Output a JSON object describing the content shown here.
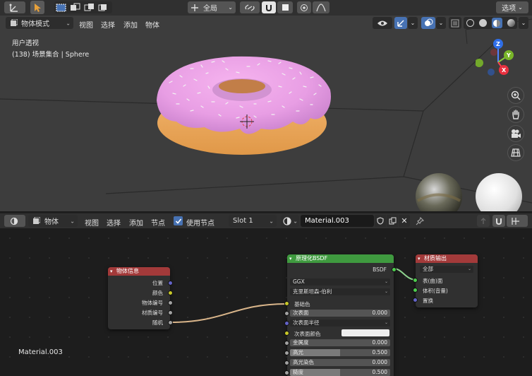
{
  "top_header": {
    "transform_label": "全局",
    "options_label": "选项"
  },
  "viewport": {
    "mode": "物体模式",
    "menus": [
      "视图",
      "选择",
      "添加",
      "物体"
    ],
    "overlay_line1": "用户透视",
    "overlay_line2": "(138) 场景集合 | Sphere",
    "gizmo": {
      "z": "Z",
      "y": "Y",
      "x": "X"
    }
  },
  "node_header": {
    "object_type": "物体",
    "menus": [
      "视图",
      "选择",
      "添加",
      "节点"
    ],
    "use_nodes_label": "使用节点",
    "slot": "Slot 1",
    "material_name": "Material.003"
  },
  "node_editor": {
    "material_label": "Material.003",
    "object_info": {
      "title": "物体信息",
      "outputs": [
        "位置",
        "颜色",
        "物体编号",
        "材质编号",
        "随机"
      ]
    },
    "principled": {
      "title": "原理化BSDF",
      "output": "BSDF",
      "distribution": "GGX",
      "subsurface_method": "克里斯坦森-伯利",
      "base_color": "基础色",
      "subsurface_label": "次表面",
      "subsurface_value": "0.000",
      "subsurface_radius": "次表面半径",
      "subsurface_color": "次表面颜色",
      "metallic_label": "金属度",
      "metallic_value": "0.000",
      "specular_label": "高光",
      "specular_value": "0.500",
      "specular_tint_label": "高光染色",
      "specular_tint_value": "0.000",
      "roughness_label": "糙度",
      "roughness_value": "0.500"
    },
    "material_output": {
      "title": "材质输出",
      "target": "全部",
      "inputs": [
        "表(曲)面",
        "体积(音量)",
        "置换"
      ]
    }
  },
  "colors": {
    "object_info_header": "#a33a3a",
    "principled_header": "#3f9a3f",
    "output_header": "#a33a3a",
    "active_blue": "#4772b3"
  }
}
